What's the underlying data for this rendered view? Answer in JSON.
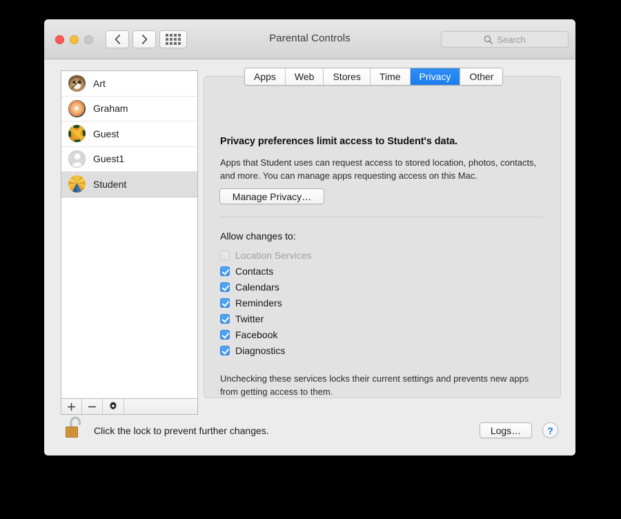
{
  "window": {
    "title": "Parental Controls",
    "traffic_lights": [
      "close",
      "minimize",
      "zoom"
    ],
    "colors": {
      "close": "#fc5b57",
      "minimize": "#f6bd3f",
      "zoom": "#c9c9c9",
      "accent_blue": "#1a7dee",
      "checkbox_blue": "#3e93f2",
      "help_blue": "#1474e8",
      "window_bg": "#ececec",
      "panel_bg": "#e2e2e2"
    }
  },
  "toolbar": {
    "back_label": "Back",
    "forward_label": "Forward",
    "show_all_label": "Show All"
  },
  "search": {
    "placeholder": "Search",
    "value": ""
  },
  "sidebar": {
    "users": [
      {
        "name": "Art",
        "avatar": "cat-photo-avatar",
        "selected": false
      },
      {
        "name": "Graham",
        "avatar": "rose-photo-avatar",
        "selected": false
      },
      {
        "name": "Guest",
        "avatar": "poppy-photo-avatar",
        "selected": false
      },
      {
        "name": "Guest1",
        "avatar": "default-person-avatar",
        "selected": false
      },
      {
        "name": "Student",
        "avatar": "sunflower-photo-avatar",
        "selected": true
      }
    ],
    "toolbar": {
      "add_label": "+",
      "remove_label": "−",
      "settings_label": "gear"
    }
  },
  "tabs": [
    {
      "label": "Apps",
      "active": false
    },
    {
      "label": "Web",
      "active": false
    },
    {
      "label": "Stores",
      "active": false
    },
    {
      "label": "Time",
      "active": false
    },
    {
      "label": "Privacy",
      "active": true
    },
    {
      "label": "Other",
      "active": false
    }
  ],
  "privacy": {
    "headline": "Privacy preferences limit access to Student's data.",
    "description": "Apps that Student uses can request access to stored location, photos, contacts, and more. You can manage apps requesting access on this Mac.",
    "manage_button": "Manage Privacy…",
    "allow_label": "Allow changes to:",
    "services": [
      {
        "label": "Location Services",
        "checked": false,
        "disabled": true
      },
      {
        "label": "Contacts",
        "checked": true,
        "disabled": false
      },
      {
        "label": "Calendars",
        "checked": true,
        "disabled": false
      },
      {
        "label": "Reminders",
        "checked": true,
        "disabled": false
      },
      {
        "label": "Twitter",
        "checked": true,
        "disabled": false
      },
      {
        "label": "Facebook",
        "checked": true,
        "disabled": false
      },
      {
        "label": "Diagnostics",
        "checked": true,
        "disabled": false
      }
    ],
    "footnote": "Unchecking these services locks their current settings and prevents new apps from getting access to them."
  },
  "footer": {
    "lock_state": "unlocked",
    "lock_text": "Click the lock to prevent further changes.",
    "logs_button": "Logs…",
    "help_button": "?"
  }
}
